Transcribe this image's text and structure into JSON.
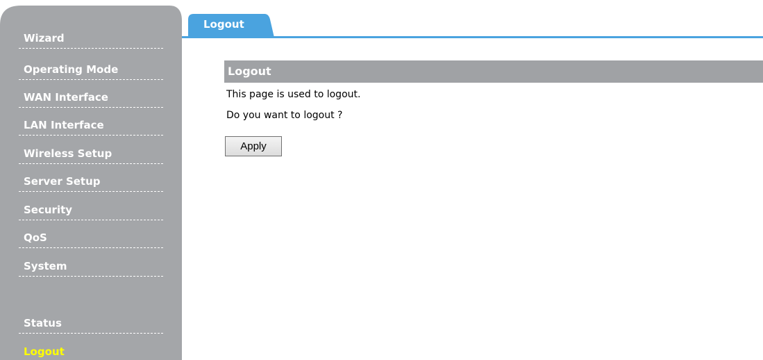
{
  "sidebar": {
    "items": [
      {
        "label": "Wizard"
      },
      {
        "label": "Operating Mode"
      },
      {
        "label": "WAN Interface"
      },
      {
        "label": "LAN Interface"
      },
      {
        "label": "Wireless Setup"
      },
      {
        "label": "Server Setup"
      },
      {
        "label": "Security"
      },
      {
        "label": "QoS"
      },
      {
        "label": "System"
      },
      {
        "label": "Status"
      },
      {
        "label": "Logout"
      }
    ],
    "active_item": "Logout",
    "active_color": "#ffff00",
    "background_color": "#a4a6a9"
  },
  "tab": {
    "label": "Logout",
    "color": "#4aa3df"
  },
  "main": {
    "section_title": "Logout",
    "description": "This page is used to logout.",
    "question": "Do you want to logout ?",
    "apply_label": "Apply"
  }
}
